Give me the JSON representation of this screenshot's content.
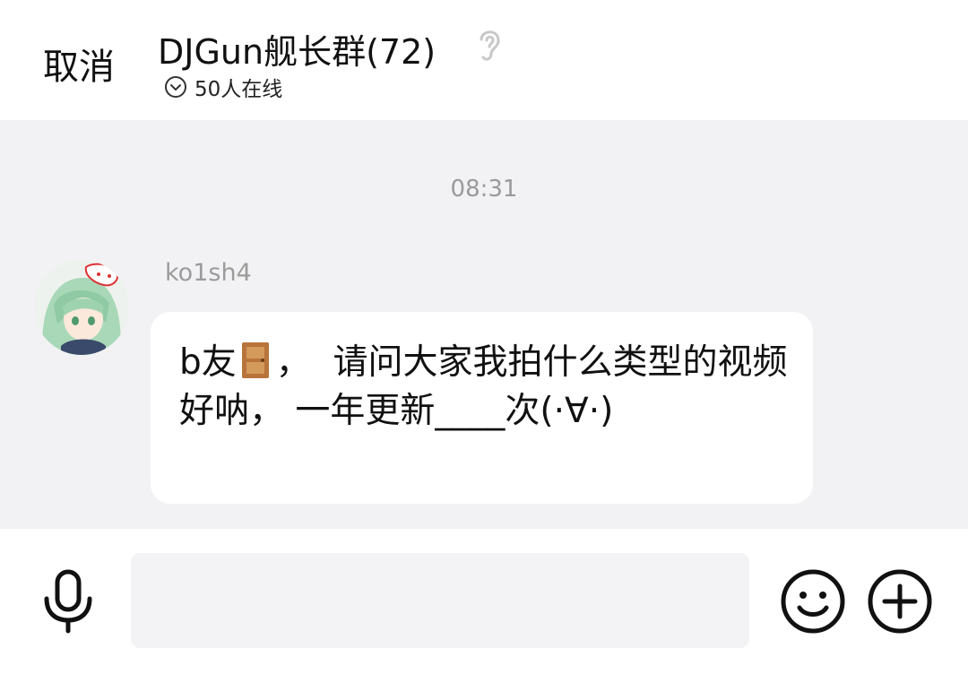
{
  "header": {
    "cancel_label": "取消",
    "title": "DJGun舰长群(72)",
    "online_text": "50人在线"
  },
  "chat": {
    "timestamp": "08:31",
    "messages": [
      {
        "sender": "ko1sh4",
        "text_part1": "b友",
        "text_part2": "，  请问大家我拍什么类型的视频好呐， 一年更新____次(·∀·)",
        "emoji_icon": "door-icon"
      }
    ]
  },
  "footer": {
    "input_value": "",
    "icons": [
      "microphone-icon",
      "smiley-icon",
      "plus-circle-icon"
    ]
  },
  "colors": {
    "background": "#f2f2f4",
    "surface": "#ffffff",
    "muted_text": "#9a9a9a"
  }
}
